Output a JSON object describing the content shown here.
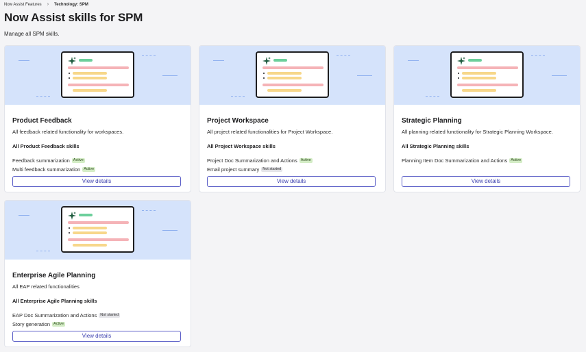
{
  "breadcrumb": {
    "parent": "Now Assist Features",
    "current": "Technology: SPM"
  },
  "page": {
    "title": "Now Assist skills for SPM",
    "subtitle": "Manage all SPM skills."
  },
  "colors": {
    "hero_bg": "#d5e3fb",
    "accent": "#5b5fc7",
    "active_badge": "#d3ecc5",
    "not_started_badge": "#e4e4e8"
  },
  "cards": [
    {
      "title": "Product Feedback",
      "description": "All feedback related functionality for workspaces.",
      "skills_heading": "All Product Feedback skills",
      "skills": [
        {
          "name": "Feedback summarization",
          "status": "Active"
        },
        {
          "name": "Multi feedback summarization",
          "status": "Active"
        }
      ],
      "button": "View details"
    },
    {
      "title": "Project Workspace",
      "description": "All project related functionalities for Project Workspace.",
      "skills_heading": "All Project Workspace skills",
      "skills": [
        {
          "name": "Project Doc Summarization and Actions",
          "status": "Active"
        },
        {
          "name": "Email project summary",
          "status": "Not started"
        }
      ],
      "button": "View details"
    },
    {
      "title": "Strategic Planning",
      "description": "All planning related functionality for Strategic Planning Workspace.",
      "skills_heading": "All Strategic Planning skills",
      "skills": [
        {
          "name": "Planning Item Doc Summarization and Actions",
          "status": "Active"
        }
      ],
      "button": "View details"
    },
    {
      "title": "Enterprise Agile Planning",
      "description": "All EAP related functionalities",
      "skills_heading": "All Enterprise Agile Planning skills",
      "skills": [
        {
          "name": "EAP Doc Summarization and Actions",
          "status": "Not started"
        },
        {
          "name": "Story generation",
          "status": "Active"
        }
      ],
      "button": "View details"
    }
  ]
}
